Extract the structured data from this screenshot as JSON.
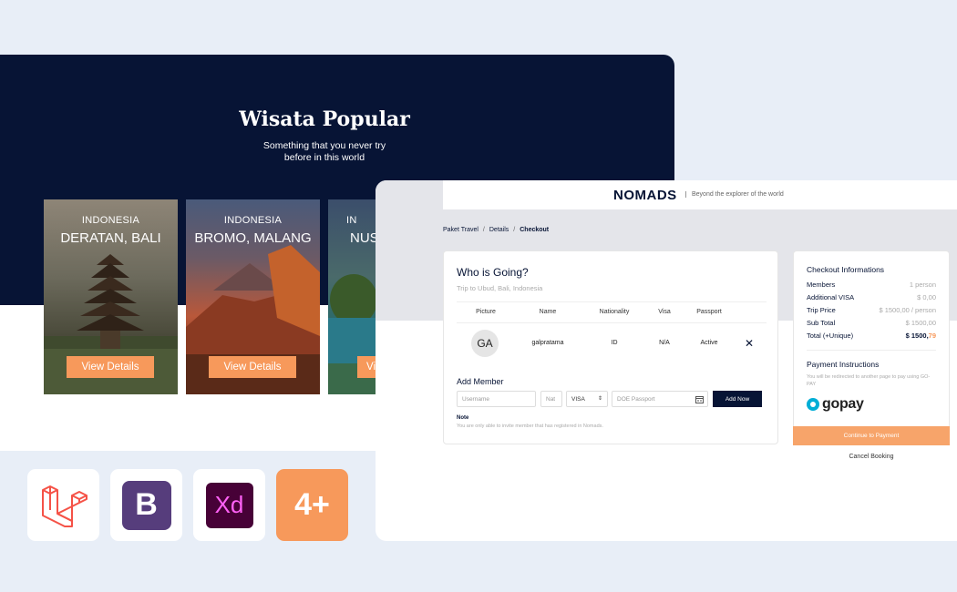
{
  "hero": {
    "title": "Wisata Popular",
    "subtitle": "Something that you never try before in this world"
  },
  "destinations": [
    {
      "country": "INDONESIA",
      "place": "DERATAN, BALI",
      "button": "View Details"
    },
    {
      "country": "INDONESIA",
      "place": "BROMO, MALANG",
      "button": "View Details"
    },
    {
      "country": "IN",
      "place": "NUS",
      "button": "Vi"
    }
  ],
  "tech_badges": [
    {
      "name": "laravel-logo"
    },
    {
      "name": "bootstrap-logo",
      "label": "B"
    },
    {
      "name": "adobe-xd-logo",
      "label": "Xd"
    },
    {
      "name": "more-badge",
      "label": "4+"
    }
  ],
  "nav": {
    "logo": "NOMADS",
    "tagline": "Beyond the explorer of the world"
  },
  "breadcrumb": {
    "items": [
      "Paket Travel",
      "Details"
    ],
    "active": "Checkout",
    "separator": "/"
  },
  "checkout": {
    "title": "Who is Going?",
    "trip": "Trip to Ubud, Bali, Indonesia",
    "columns": [
      "Picture",
      "Name",
      "Nationality",
      "Visa",
      "Passport"
    ],
    "member": {
      "initials": "GA",
      "name": "galpratama",
      "nationality": "ID",
      "visa": "N/A",
      "passport": "Active"
    },
    "add_member": {
      "title": "Add Member",
      "username_placeholder": "Username",
      "nat_placeholder": "Nat",
      "visa_value": "VISA",
      "passport_placeholder": "DOE Passport",
      "button": "Add Now"
    },
    "note_title": "Note",
    "note": "You are only able to invite member that has registered in Nomads."
  },
  "summary": {
    "title": "Checkout Informations",
    "rows": [
      {
        "label": "Members",
        "value": "1 person"
      },
      {
        "label": "Additional VISA",
        "value": "$ 0,00"
      },
      {
        "label": "Trip Price",
        "value": "$ 1500,00 / person"
      },
      {
        "label": "Sub Total",
        "value": "$ 1500,00"
      }
    ],
    "total": {
      "label": "Total (+Unique)",
      "value": "$ 1500,",
      "unique": "79"
    },
    "payment_title": "Payment Instructions",
    "payment_info": "You will be redirected to another page to pay using GO-PAY",
    "gopay": "gopay",
    "continue": "Continue to Payment",
    "cancel": "Cancel Booking"
  },
  "colors": {
    "navy": "#071435",
    "accent": "#f7995b",
    "laravel": "#f55247",
    "bootstrap": "#563d7c",
    "xd": "#470137"
  }
}
